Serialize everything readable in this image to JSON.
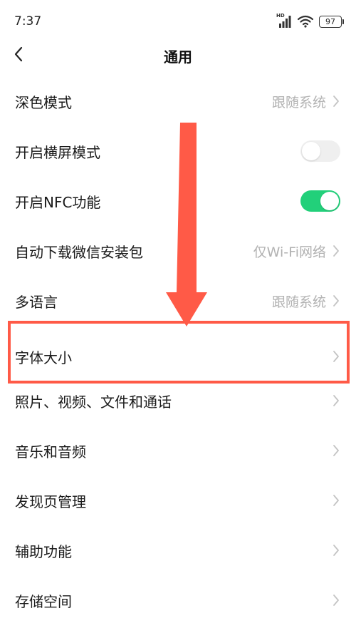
{
  "status_bar": {
    "time": "7:37",
    "network_label": "HD",
    "battery": "97"
  },
  "navbar": {
    "title": "通用"
  },
  "settings": [
    {
      "label": "深色模式",
      "value": "跟随系统",
      "type": "link"
    },
    {
      "label": "开启横屏模式",
      "type": "toggle",
      "on": false
    },
    {
      "label": "开启NFC功能",
      "type": "toggle",
      "on": true
    },
    {
      "label": "自动下载微信安装包",
      "value": "仅Wi-Fi网络",
      "type": "link"
    },
    {
      "label": "多语言",
      "value": "跟随系统",
      "type": "link"
    },
    {
      "label": "字体大小",
      "type": "link"
    },
    {
      "label": "照片、视频、文件和通话",
      "type": "link"
    },
    {
      "label": "音乐和音频",
      "type": "link"
    },
    {
      "label": "发现页管理",
      "type": "link"
    },
    {
      "label": "辅助功能",
      "type": "link"
    },
    {
      "label": "存储空间",
      "type": "link"
    }
  ],
  "colors": {
    "toggle_on": "#22d07a",
    "toggle_off": "#efefef",
    "annotation": "#ff5a47",
    "secondary_text": "#b2b2b2"
  }
}
